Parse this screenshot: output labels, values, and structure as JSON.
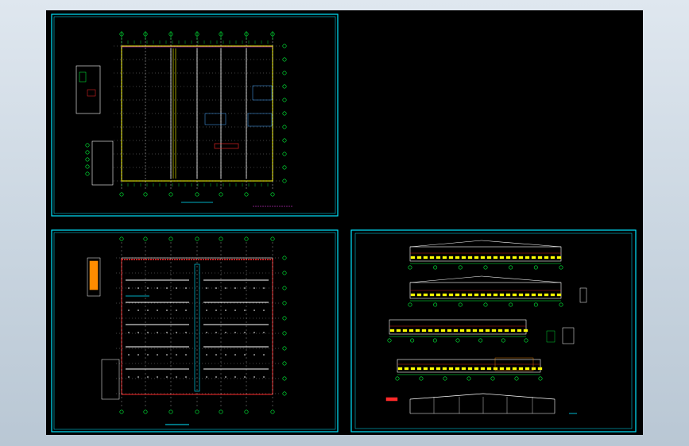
{
  "drawing": {
    "background": "#000000",
    "frame_color": "#00e5ff",
    "colors": {
      "grid": "#ffffff",
      "axis": "#00ff3c",
      "wall": "#ffff00",
      "cyan": "#00e5ff",
      "red": "#ff2a2a",
      "magenta": "#ff3cff",
      "orange": "#ff8c00",
      "blue": "#4aa8ff"
    }
  },
  "sheets": [
    {
      "name": "floor-plan-sheet",
      "title": "",
      "note": ""
    },
    {
      "name": "roof-plan-sheet",
      "title": ""
    },
    {
      "name": "elevations-sheet",
      "title": ""
    }
  ]
}
